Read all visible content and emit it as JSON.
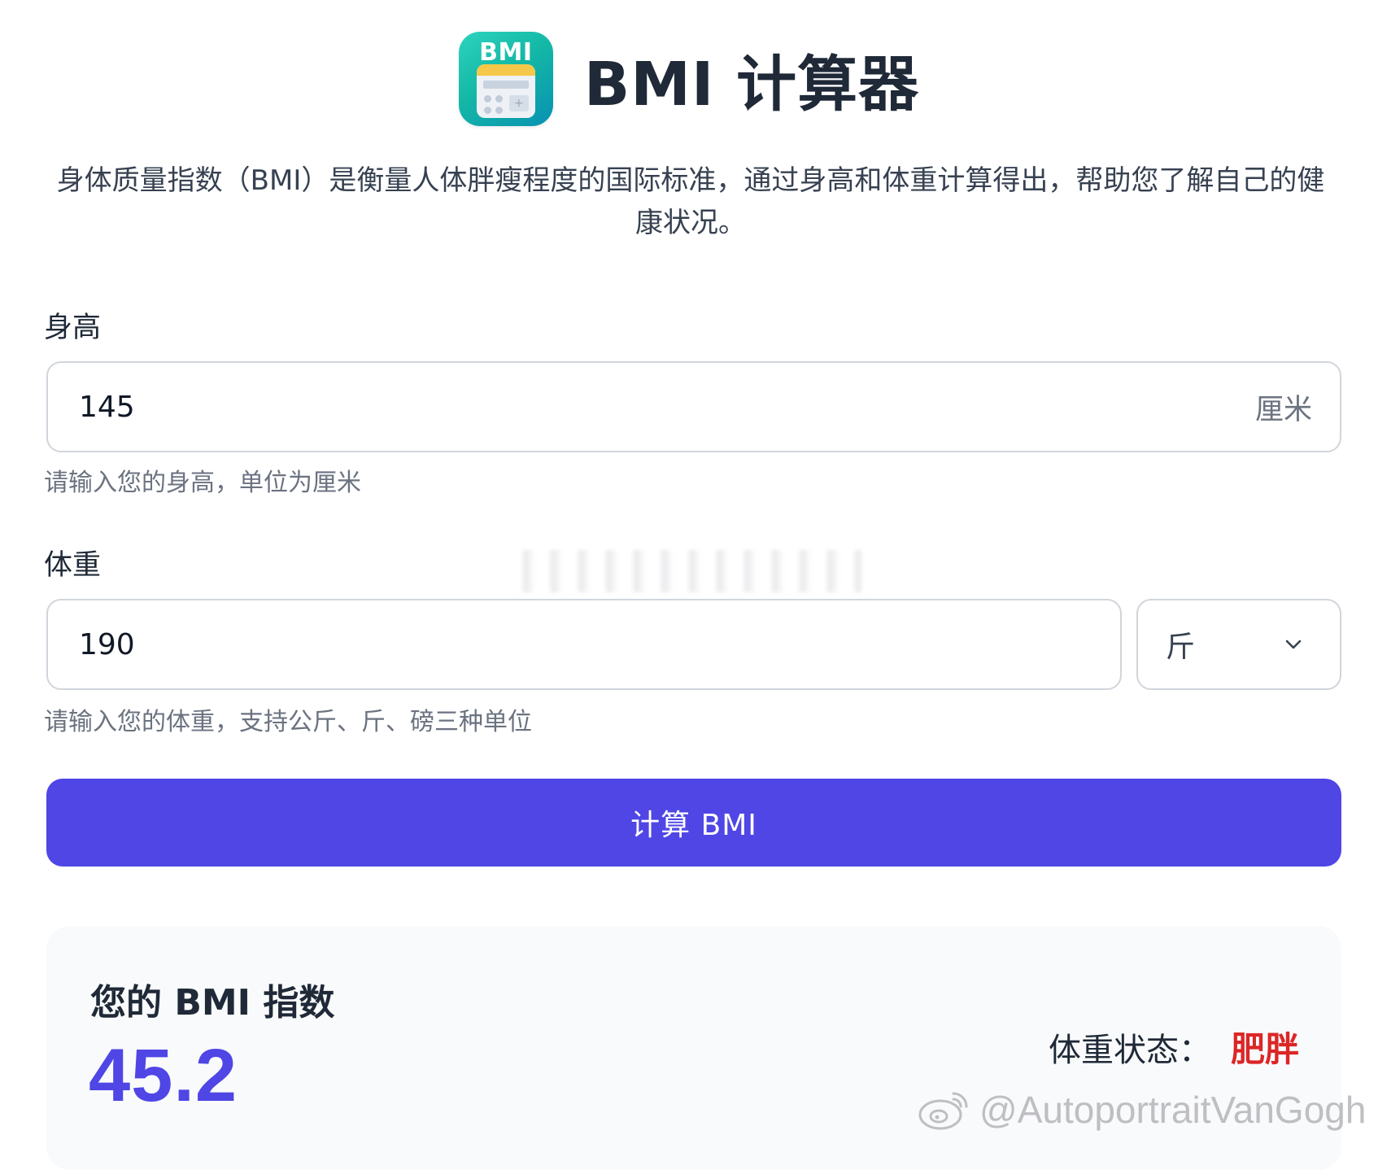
{
  "app": {
    "icon_label": "BMI",
    "title": "BMI 计算器"
  },
  "intro": "身体质量指数（BMI）是衡量人体胖瘦程度的国际标准，通过身高和体重计算得出，帮助您了解自己的健康状况。",
  "height_field": {
    "label": "身高",
    "value": "145",
    "unit": "厘米",
    "hint": "请输入您的身高，单位为厘米"
  },
  "weight_field": {
    "label": "体重",
    "value": "190",
    "unit_selected": "斤",
    "hint": "请输入您的体重，支持公斤、斤、磅三种单位"
  },
  "calculate_button": "计算 BMI",
  "result": {
    "title": "您的 BMI 指数",
    "value": "45.2",
    "status_label": "体重状态：",
    "status_value": "肥胖"
  },
  "watermark": "@AutoportraitVanGogh",
  "colors": {
    "primary": "#4f46e5",
    "danger": "#dc2626",
    "icon_gradient_start": "#2dd4bf",
    "icon_gradient_end": "#0891b2"
  },
  "icons": {
    "app": "bmi-calculator-icon",
    "select": "chevron-down-icon",
    "watermark": "weibo-logo-icon"
  }
}
